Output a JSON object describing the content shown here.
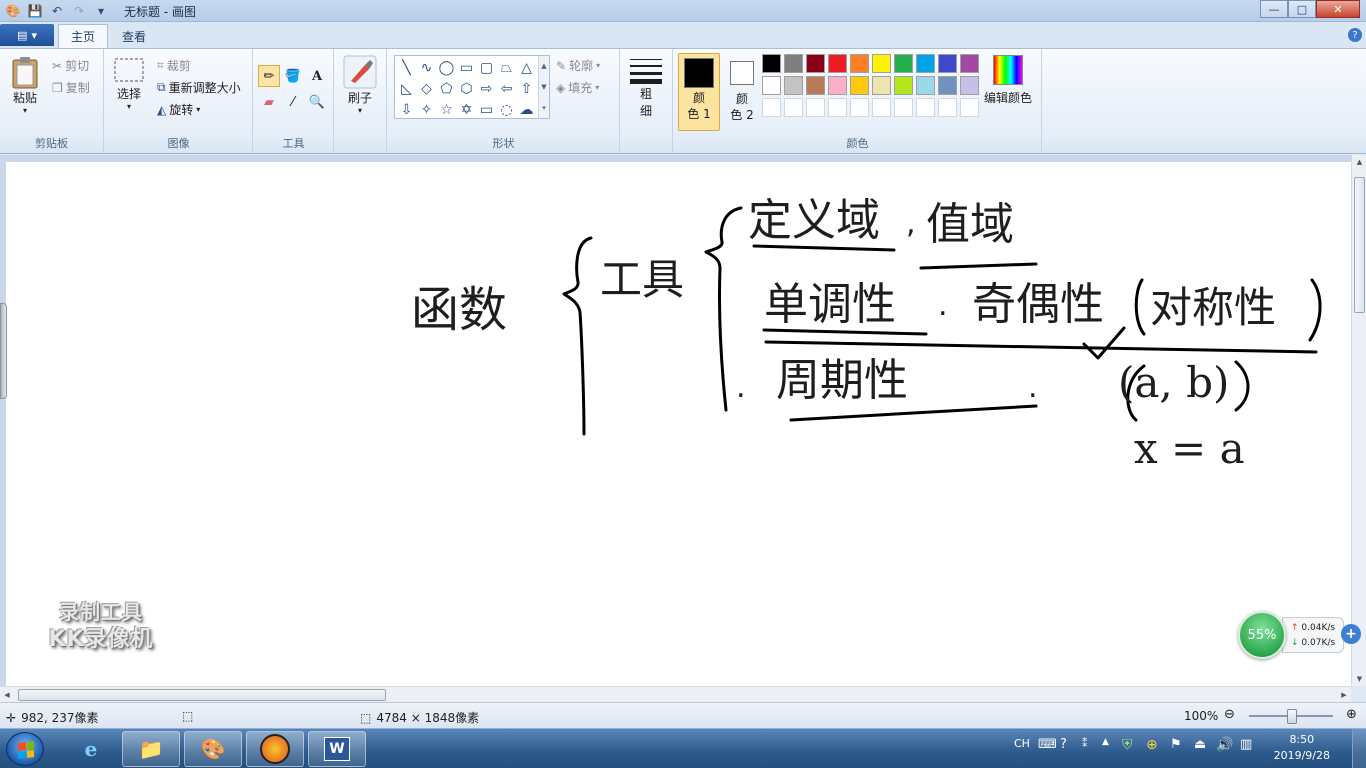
{
  "window": {
    "title": "无标题 - 画图",
    "controls": {
      "minimize": "—",
      "maximize": "□",
      "close": "✕"
    }
  },
  "tabs": {
    "file_menu": "▾",
    "home": "主页",
    "view": "查看",
    "help": "?"
  },
  "ribbon": {
    "clipboard": {
      "label": "剪贴板",
      "paste": "粘贴",
      "cut": "剪切",
      "copy": "复制"
    },
    "image": {
      "label": "图像",
      "select": "选择",
      "crop": "裁剪",
      "resize": "重新调整大小",
      "rotate": "旋转"
    },
    "tools": {
      "label": "工具"
    },
    "brushes": {
      "label": "刷子"
    },
    "shapes": {
      "label": "形状",
      "outline": "轮廓",
      "fill": "填充"
    },
    "size": {
      "label_top": "粗",
      "label_bottom": "细"
    },
    "colors": {
      "label": "颜色",
      "color1_top": "颜",
      "color1_bottom": "色 1",
      "color2_top": "颜",
      "color2_bottom": "色 2",
      "edit_colors": "编辑颜色",
      "color1": "#000000",
      "color2": "#ffffff",
      "palette": [
        "#000000",
        "#7f7f7f",
        "#880015",
        "#ed1c24",
        "#ff7f27",
        "#fff200",
        "#22b14c",
        "#00a2e8",
        "#3f48cc",
        "#a349a4",
        "#ffffff",
        "#c3c3c3",
        "#b97a57",
        "#ffaec9",
        "#ffc90e",
        "#efe4b0",
        "#b5e61d",
        "#99d9ea",
        "#7092be",
        "#c8bfe7",
        "#ffffff",
        "#ffffff",
        "#ffffff",
        "#ffffff",
        "#ffffff",
        "#ffffff",
        "#ffffff",
        "#ffffff",
        "#ffffff",
        "#ffffff"
      ]
    }
  },
  "canvas": {
    "handwriting": [
      "函数",
      "工具",
      "定义域",
      "值域",
      "单调性",
      "奇偶性",
      "对称性",
      "周期性",
      "(a, b)",
      "x = a"
    ]
  },
  "status": {
    "cursor_pos": "982, 237像素",
    "image_size": "4784 × 1848像素",
    "zoom": "100%"
  },
  "watermark": {
    "line1": "录制工具",
    "line2": "KK录像机"
  },
  "net_widget": {
    "percent": "55%",
    "upload": "0.04K/s",
    "download": "0.07K/s"
  },
  "taskbar": {
    "ime": "CH",
    "time": "8:50",
    "date": "2019/9/28",
    "apps": [
      "internet-explorer",
      "file-explorer",
      "paint",
      "kk-recorder",
      "word"
    ]
  }
}
